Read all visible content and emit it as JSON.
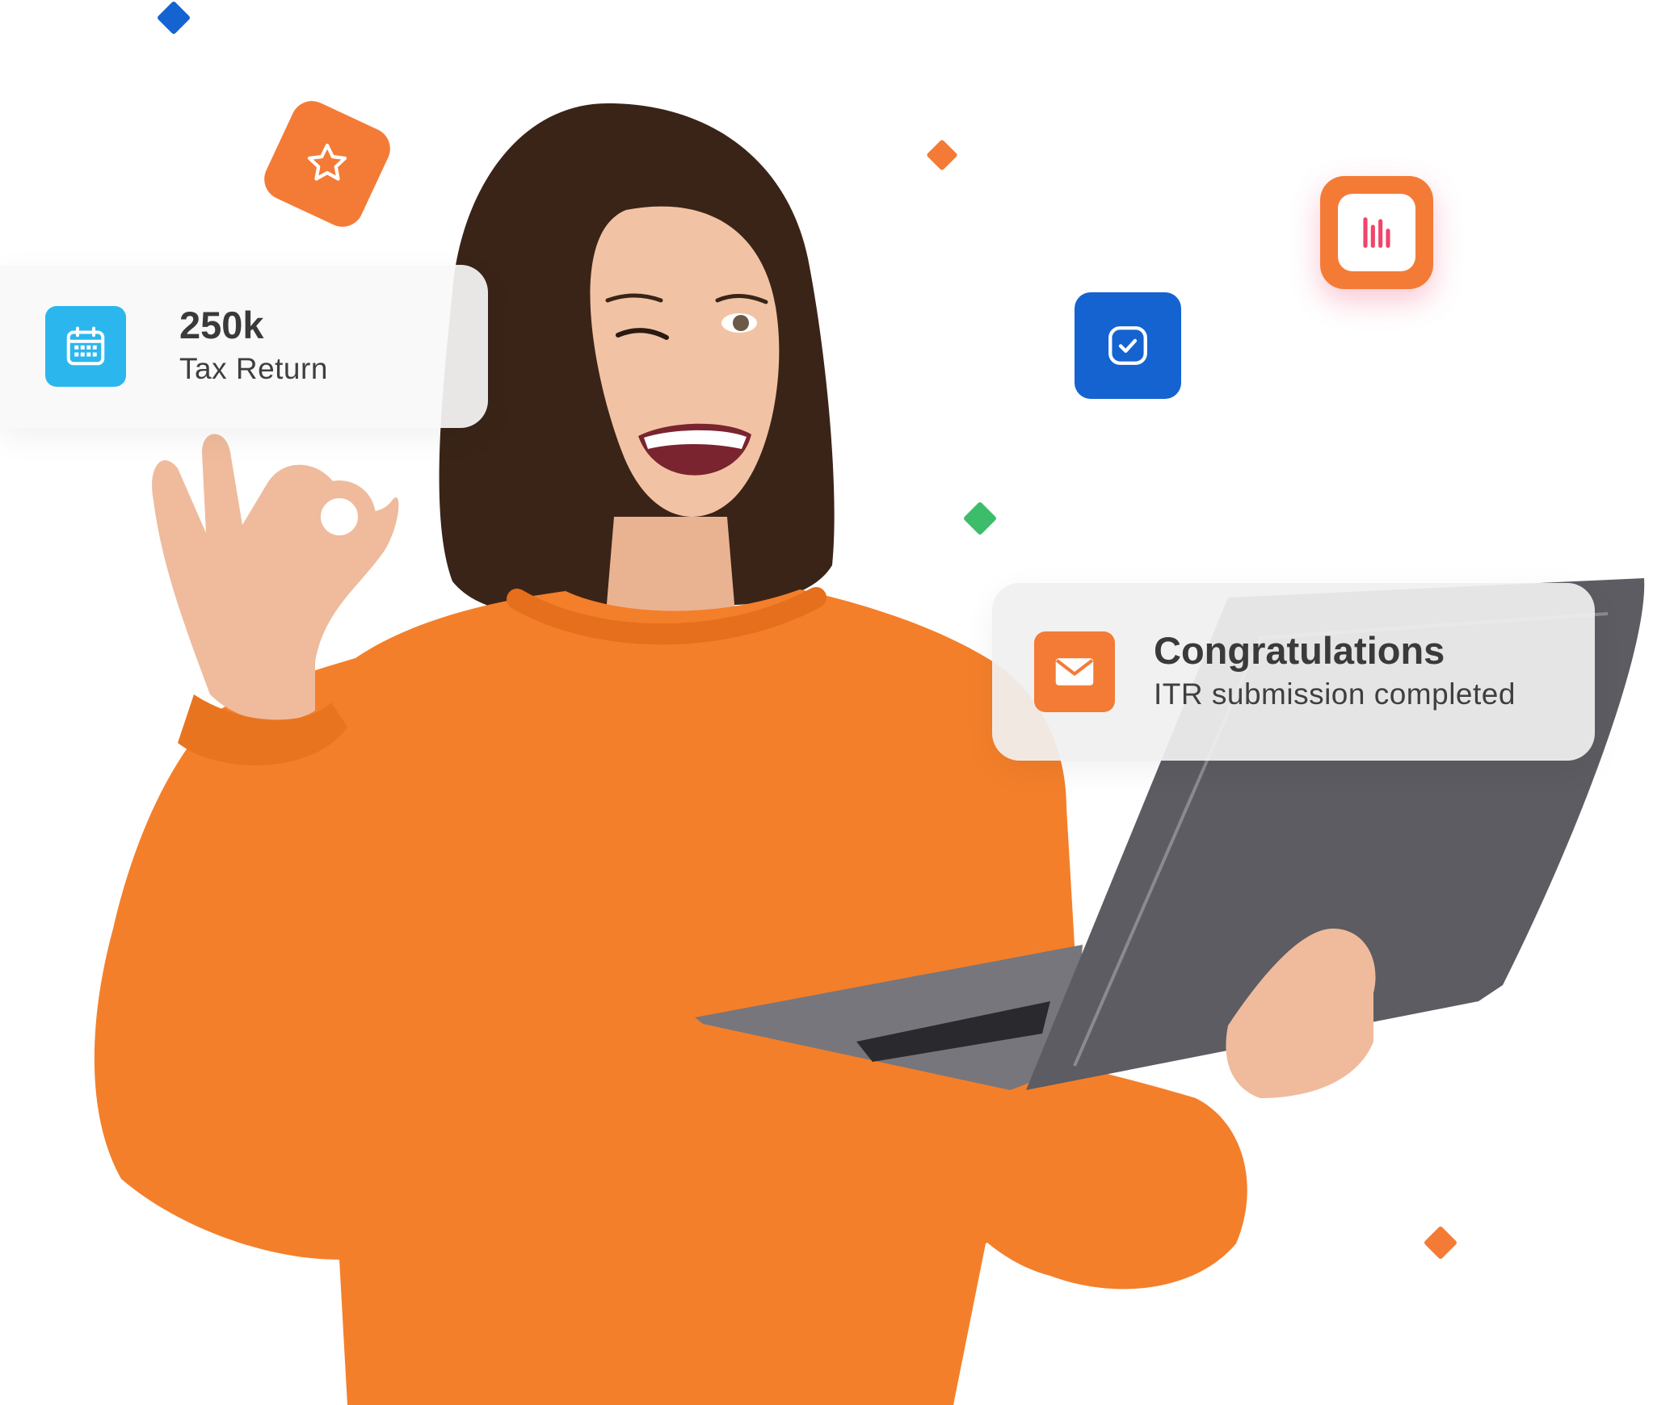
{
  "colors": {
    "accent_orange": "#F47B36",
    "accent_blue": "#1463D1",
    "accent_green": "#3DBD6B",
    "calendar_blue": "#2BB6EE",
    "bars_pink": "#F0456B",
    "sweater_orange": "#F47F2A",
    "laptop_gray": "#5c5c62"
  },
  "icons": {
    "star": "star-icon",
    "calendar": "calendar-icon",
    "check": "checkbox-check-icon",
    "bars": "bar-chart-icon",
    "mail": "mail-icon"
  },
  "stat_card": {
    "value": "250k",
    "label": "Tax Return"
  },
  "notification_card": {
    "title": "Congratulations",
    "message": "ITR submission completed"
  }
}
